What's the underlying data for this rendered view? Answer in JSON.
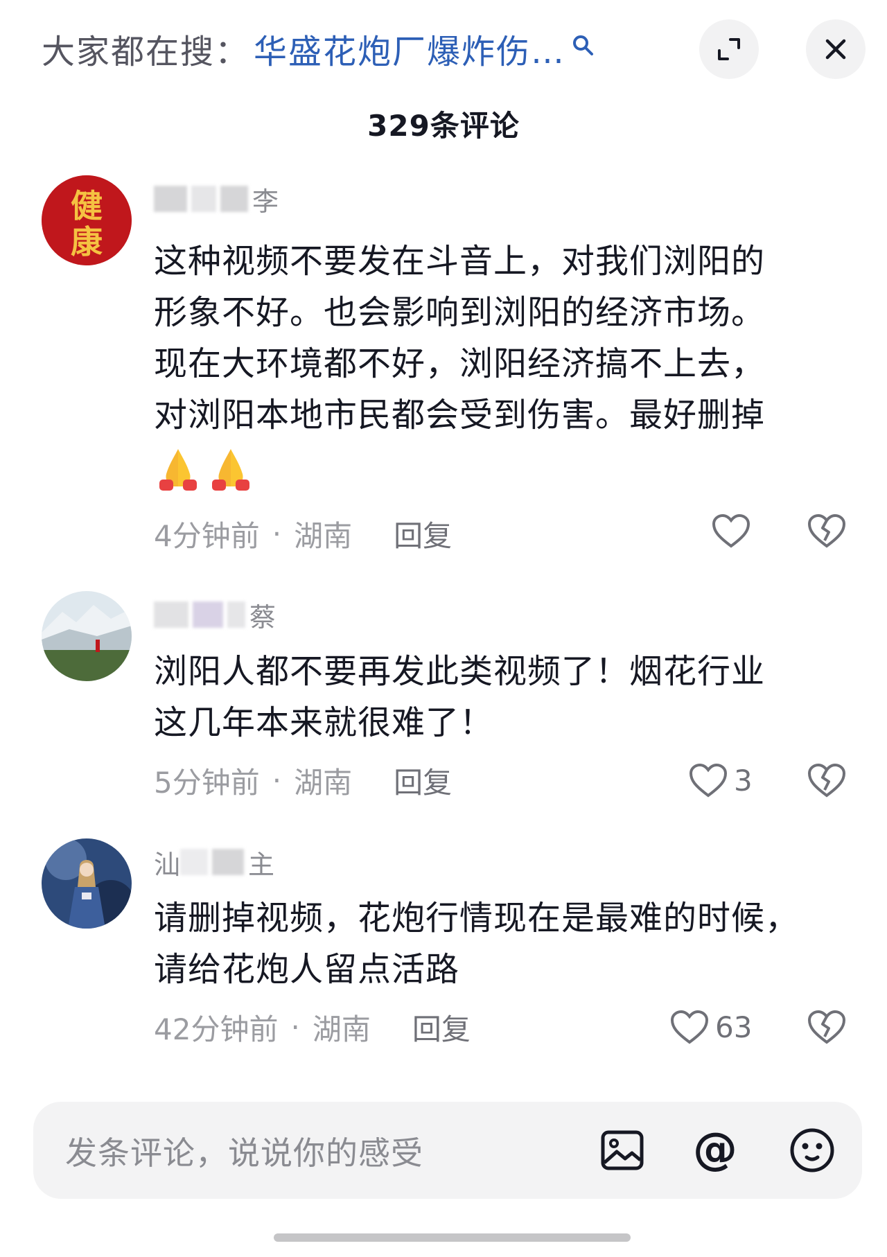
{
  "header": {
    "search_prefix": "大家都在搜：",
    "search_query": "华盛花炮厂爆炸伤…",
    "search_icon": "search-icon",
    "expand_icon": "expand-icon",
    "close_icon": "close-icon"
  },
  "comment_count": "329条评论",
  "comments": [
    {
      "username_tail": "李",
      "avatar_text": "健康",
      "text_lines": [
        "这种视频不要发在斗音上，对我们浏阳的",
        "形象不好。也会影响到浏阳的经济市场。",
        "现在大环境都不好，浏阳经济搞不上去，",
        "对浏阳本地市民都会受到伤害。最好删掉"
      ],
      "emojis": [
        "🙏",
        "🙏"
      ],
      "time": "4分钟前",
      "location": "湖南",
      "reply_label": "回复",
      "like_count": ""
    },
    {
      "username_tail": "蔡",
      "text_lines": [
        "浏阳人都不要再发此类视频了！烟花行业",
        "这几年本来就很难了！"
      ],
      "time": "5分钟前",
      "location": "湖南",
      "reply_label": "回复",
      "like_count": "3"
    },
    {
      "username_head": "汕",
      "username_tail": "主",
      "text_lines": [
        "请删掉视频，花炮行情现在是最难的时候，",
        "请给花炮人留点活路"
      ],
      "time": "42分钟前",
      "location": "湖南",
      "reply_label": "回复",
      "like_count": "63"
    }
  ],
  "separator": "·",
  "input": {
    "placeholder": "发条评论，说说你的感受",
    "icons": [
      "image-icon",
      "at-icon",
      "emoji-icon"
    ],
    "at_symbol": "@"
  },
  "colors": {
    "link_blue": "#2d5fb6",
    "text_dark": "#161823",
    "text_gray": "#9b9ca1",
    "avatar_red": "#c0171c"
  }
}
